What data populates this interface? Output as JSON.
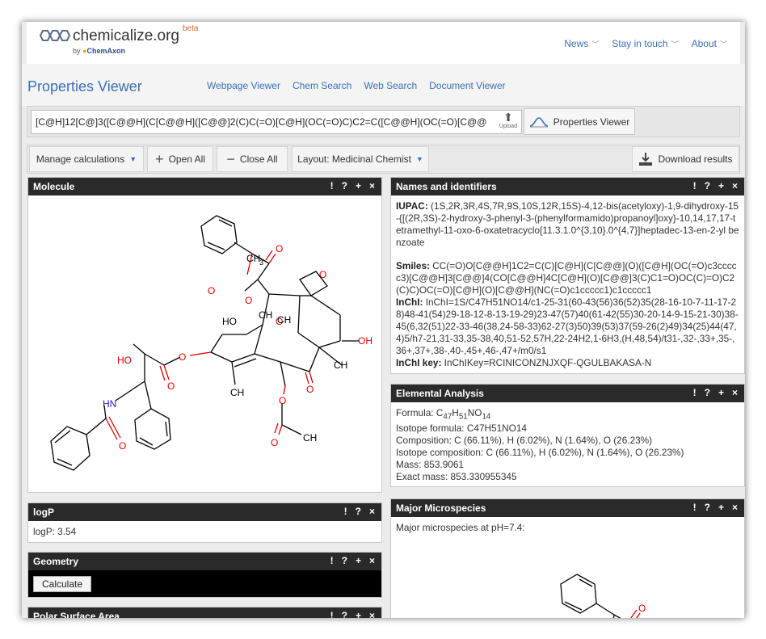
{
  "header": {
    "logo_text": "chemicalize.org",
    "logo_beta": "beta",
    "logo_by": "by",
    "logo_company": "ChemAxon",
    "nav": [
      {
        "label": "News"
      },
      {
        "label": "Stay in touch"
      },
      {
        "label": "About"
      }
    ]
  },
  "titlebar": {
    "title": "Properties Viewer",
    "links": [
      "Webpage Viewer",
      "Chem Search",
      "Web Search",
      "Document Viewer"
    ]
  },
  "input": {
    "smiles_value": "[C@H]12[C@]3([C@@H](C[C@@H]([C@@]2(C)C(=O)[C@H](OC(=O)C)C2=C([C@@H](OC(=O)[C@@",
    "upload_label": "Upload",
    "properties_button": "Properties Viewer"
  },
  "toolbar": {
    "manage": "Manage calculations",
    "open_all": "Open All",
    "close_all": "Close All",
    "layout": "Layout: Medicinal Chemist",
    "download": "Download results"
  },
  "controls": [
    "!",
    "?",
    "+",
    "×"
  ],
  "panels": {
    "molecule": {
      "title": "Molecule"
    },
    "logp": {
      "title": "logP",
      "text": "logP: 3.54"
    },
    "geometry": {
      "title": "Geometry",
      "button": "Calculate"
    },
    "polar": {
      "title": "Polar Surface Area"
    },
    "names": {
      "title": "Names and identifiers",
      "iupac_label": "IUPAC:",
      "iupac": "(1S,2R,3R,4S,7R,9S,10S,12R,15S)-4,12-bis(acetyloxy)-1,9-dihydroxy-15-{[(2R,3S)-2-hydroxy-3-phenyl-3-(phenylformamido)propanoyl]oxy}-10,14,17,17-tetramethyl-11-oxo-6-oxatetracyclo[11.3.1.0^{3,10}.0^{4,7}]heptadec-13-en-2-yl benzoate",
      "smiles_label": "Smiles:",
      "smiles": "CC(=O)O[C@@H]1C2=C(C)[C@H](C[C@@](O)([C@H](OC(=O)c3ccccc3)[C@@H]3[C@@]4(CO[C@@H]4C[C@H](O)[C@@]3(C)C1=O)OC(C)=O)C2(C)C)OC(=O)[C@H](O)[C@@H](NC(=O)c1ccccc1)c1ccccc1",
      "inchi_label": "InChI:",
      "inchi": "InChI=1S/C47H51NO14/c1-25-31(60-43(56)36(52)35(28-16-10-7-11-17-28)48-41(54)29-18-12-8-13-19-29)23-47(57)40(61-42(55)30-20-14-9-15-21-30)38-45(6,32(51)22-33-46(38,24-58-33)62-27(3)50)39(53)37(59-26(2)49)34(25)44(47,4)5/h7-21,31-33,35-38,40,51-52,57H,22-24H2,1-6H3,(H,48,54)/t31-,32-,33+,35-,36+,37+,38-,40-,45+,46-,47+/m0/s1",
      "inchikey_label": "InChI key:",
      "inchikey": "InChIKey=RCINICONZNJXQF-QGULBAKASA-N"
    },
    "elemental": {
      "title": "Elemental Analysis",
      "formula_label": "Formula: ",
      "formula_parts": [
        {
          "t": "C"
        },
        {
          "s": "47"
        },
        {
          "t": "H"
        },
        {
          "s": "51"
        },
        {
          "t": "NO"
        },
        {
          "s": "14"
        }
      ],
      "isotope_formula": "Isotope formula: C47H51NO14",
      "composition": "Composition: C (66.11%), H (6.02%), N (1.64%), O (26.23%)",
      "isotope_composition": "Isotope composition: C (66.11%), H (6.02%), N (1.64%), O (26.23%)",
      "mass": "Mass: 853.9061",
      "exact_mass": "Exact mass: 853.330955345"
    },
    "micro": {
      "title": "Major Microspecies",
      "text": "Major microspecies at pH=7.4:"
    }
  },
  "molecule_labels": {
    "ch3": "CH",
    "three": "3",
    "o": "O",
    "ho": "HO",
    "oh": "OH",
    "hn": "HN"
  },
  "colors": {
    "accent": "#3a70b5",
    "oxygen": "#e00000",
    "nitrogen": "#2020c0",
    "panel_header": "#2a2a2a"
  }
}
